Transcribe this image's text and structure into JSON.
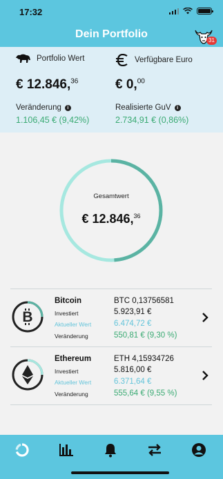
{
  "status": {
    "time": "17:32"
  },
  "header": {
    "title": "Dein Portfolio",
    "notification_count": "31"
  },
  "summary": {
    "portfolio_label": "Portfolio Wert",
    "portfolio_value_main": "€ 12.846,",
    "portfolio_value_cents": "36",
    "euro_label": "Verfügbare Euro",
    "euro_value_main": "€ 0,",
    "euro_value_cents": "00",
    "change_label": "Veränderung",
    "change_value": "1.106,45 € (9,42%)",
    "gain_label": "Realisierte GuV",
    "gain_value": "2.734,91 € (0,86%)"
  },
  "total": {
    "label": "Gesamtwert",
    "value_main": "€ 12.846,",
    "value_cents": "36",
    "bitcoin_share": 0.49,
    "ethereum_share": 0.51
  },
  "assets": [
    {
      "name": "Bitcoin",
      "amount": "BTC 0,13756581",
      "invested_label": "Investiert",
      "invested_value": "5.923,91 €",
      "current_label": "Aktueller Wert",
      "current_value": "6.474,72 €",
      "change_label": "Veränderung",
      "change_value": "550,81 € (9,30 %)"
    },
    {
      "name": "Ethereum",
      "amount": "ETH 4,15934726",
      "invested_label": "Investiert",
      "invested_value": "5.816,00 €",
      "current_label": "Aktueller Wert",
      "current_value": "6.371,64 €",
      "change_label": "Veränderung",
      "change_value": "555,64 € (9,55 %)"
    }
  ],
  "colors": {
    "accent": "#5cc6df",
    "positive": "#3aaa73",
    "ring_bitcoin": "#5bb3a3",
    "ring_ethereum": "#a6e8e0"
  },
  "tabbar": [
    "portfolio-icon",
    "chart-icon",
    "bell-icon",
    "transfer-icon",
    "account-icon"
  ]
}
